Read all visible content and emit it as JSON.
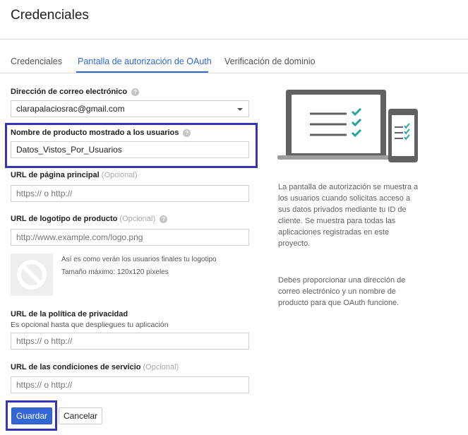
{
  "page": {
    "title": "Credenciales"
  },
  "tabs": [
    {
      "label": "Credenciales",
      "active": false
    },
    {
      "label": "Pantalla de autorización de OAuth",
      "active": true
    },
    {
      "label": "Verificación de dominio",
      "active": false
    }
  ],
  "form": {
    "email": {
      "label": "Dirección de correo electrónico",
      "value": "clarapalaciosrac@gmail.com"
    },
    "product_name": {
      "label": "Nombre de producto mostrado a los usuarios",
      "value": "Datos_Vistos_Por_Usuarios"
    },
    "homepage_url": {
      "label": "URL de página principal",
      "optional": "(Opcional)",
      "placeholder": "https:// o http://"
    },
    "logo_url": {
      "label": "URL de logotipo de producto",
      "optional": "(Opcional)",
      "placeholder": "http://www.example.com/logo.png"
    },
    "logo_preview": {
      "caption_1": "Así es como verán los usuarios finales tu logotipo",
      "caption_2": "Tamaño máximo: 120x120 píxeles"
    },
    "privacy_url": {
      "label": "URL de la política de privacidad",
      "hint": "Es opcional hasta que despliegues tu aplicación",
      "placeholder": "https:// o http://"
    },
    "tos_url": {
      "label": "URL de las condiciones de servicio",
      "optional": "(Opcional)",
      "placeholder": "https:// o http://"
    }
  },
  "buttons": {
    "save": "Guardar",
    "cancel": "Cancelar"
  },
  "help_icon_glyph": "?",
  "sidebar": {
    "paragraph_1": "La pantalla de autorización se muestra a los usuarios cuando solicitas acceso a sus datos privados mediante tu ID de cliente. Se muestra para todas las aplicaciones registradas en este proyecto.",
    "paragraph_2": "Debes proporcionar una dirección de correo electrónico y un nombre de producto para que OAuth funcione."
  },
  "colors": {
    "accent": "#3367d6",
    "highlight": "#3535b5",
    "check": "#26a69a",
    "device": "#616161"
  }
}
